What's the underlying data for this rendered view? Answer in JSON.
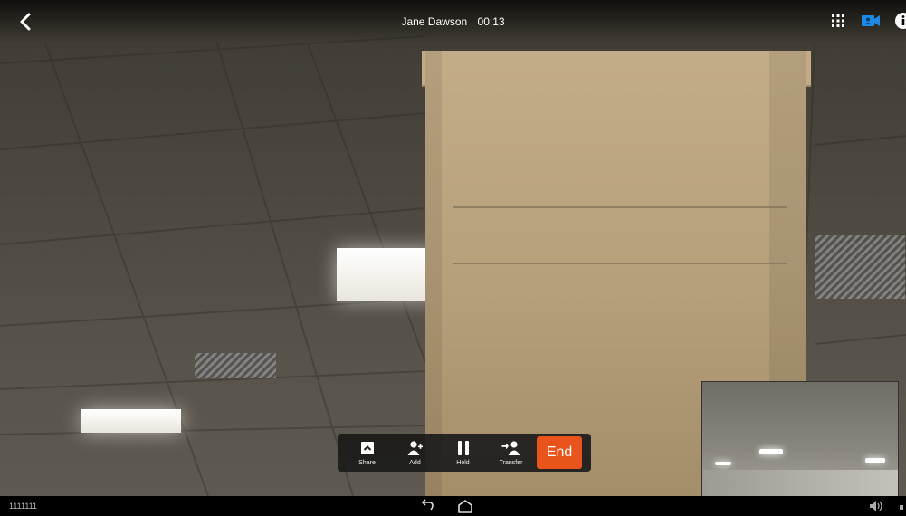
{
  "call": {
    "contact_name": "Jane Dawson",
    "duration": "00:13"
  },
  "topbar": {
    "icons": [
      "back-arrow-icon",
      "dialpad-icon",
      "video-camera-icon",
      "info-icon"
    ]
  },
  "controls": {
    "share_label": "Share",
    "add_label": "Add",
    "hold_label": "Hold",
    "transfer_label": "Transfer",
    "end_label": "End"
  },
  "system": {
    "device_id": "1111111",
    "icons": [
      "nav-back-icon",
      "nav-home-icon",
      "volume-icon"
    ]
  },
  "colors": {
    "end_button": "#e8541c",
    "video_icon_active": "#1e88e5",
    "bar_bg": "#191919"
  }
}
